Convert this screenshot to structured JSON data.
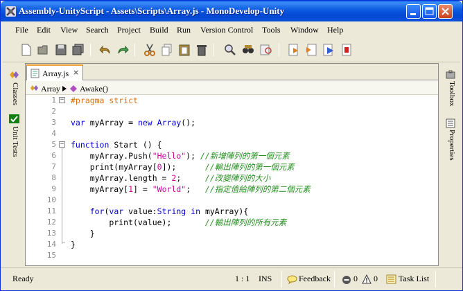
{
  "window": {
    "title": "Assembly-UnityScript - Assets\\Scripts\\Array.js - MonoDevelop-Unity"
  },
  "menu": [
    "File",
    "Edit",
    "View",
    "Search",
    "Project",
    "Build",
    "Run",
    "Version Control",
    "Tools",
    "Window",
    "Help"
  ],
  "toolbar_icons": [
    "new-file-icon",
    "open-folder-icon",
    "save-icon",
    "save-all-icon",
    "undo-icon",
    "redo-icon",
    "cut-icon",
    "copy-icon",
    "paste-icon",
    "delete-icon",
    "find-icon",
    "find-in-files-icon",
    "replace-icon",
    "build-icon",
    "build-solution-icon",
    "run-icon",
    "stop-icon"
  ],
  "left_panels": [
    "Classes",
    "Unit Tests"
  ],
  "right_panels": [
    "Toolbox",
    "Properties"
  ],
  "doc_tab": {
    "label": "Array.js",
    "close": "×"
  },
  "breadcrumb": {
    "file": "Array",
    "member": "Awake()"
  },
  "code_lines": [
    {
      "n": "1",
      "text": "#pragma strict"
    },
    {
      "n": "2",
      "text": ""
    },
    {
      "n": "3",
      "text": "var myArray = new Array();"
    },
    {
      "n": "4",
      "text": ""
    },
    {
      "n": "5",
      "text": "function Start () {"
    },
    {
      "n": "6",
      "text": "    myArray.Push(\"Hello\"); //新增陣列的第一個元素"
    },
    {
      "n": "7",
      "text": "    print(myArray[0]);      //輸出陣列的第一個元素"
    },
    {
      "n": "8",
      "text": "    myArray.length = 2;     //改變陣列的大小"
    },
    {
      "n": "9",
      "text": "    myArray[1] = \"World\";   //指定值給陣列的第二個元素"
    },
    {
      "n": "10",
      "text": ""
    },
    {
      "n": "11",
      "text": "    for(var value:String in myArray){"
    },
    {
      "n": "12",
      "text": "        print(value);       //輸出陣列的所有元素"
    },
    {
      "n": "13",
      "text": "    }"
    },
    {
      "n": "14",
      "text": "}"
    },
    {
      "n": "15",
      "text": ""
    }
  ],
  "status": {
    "ready": "Ready",
    "position": "1 : 1",
    "mode": "INS",
    "feedback": "Feedback",
    "errors": "0",
    "warnings": "0",
    "task_list": "Task List"
  }
}
